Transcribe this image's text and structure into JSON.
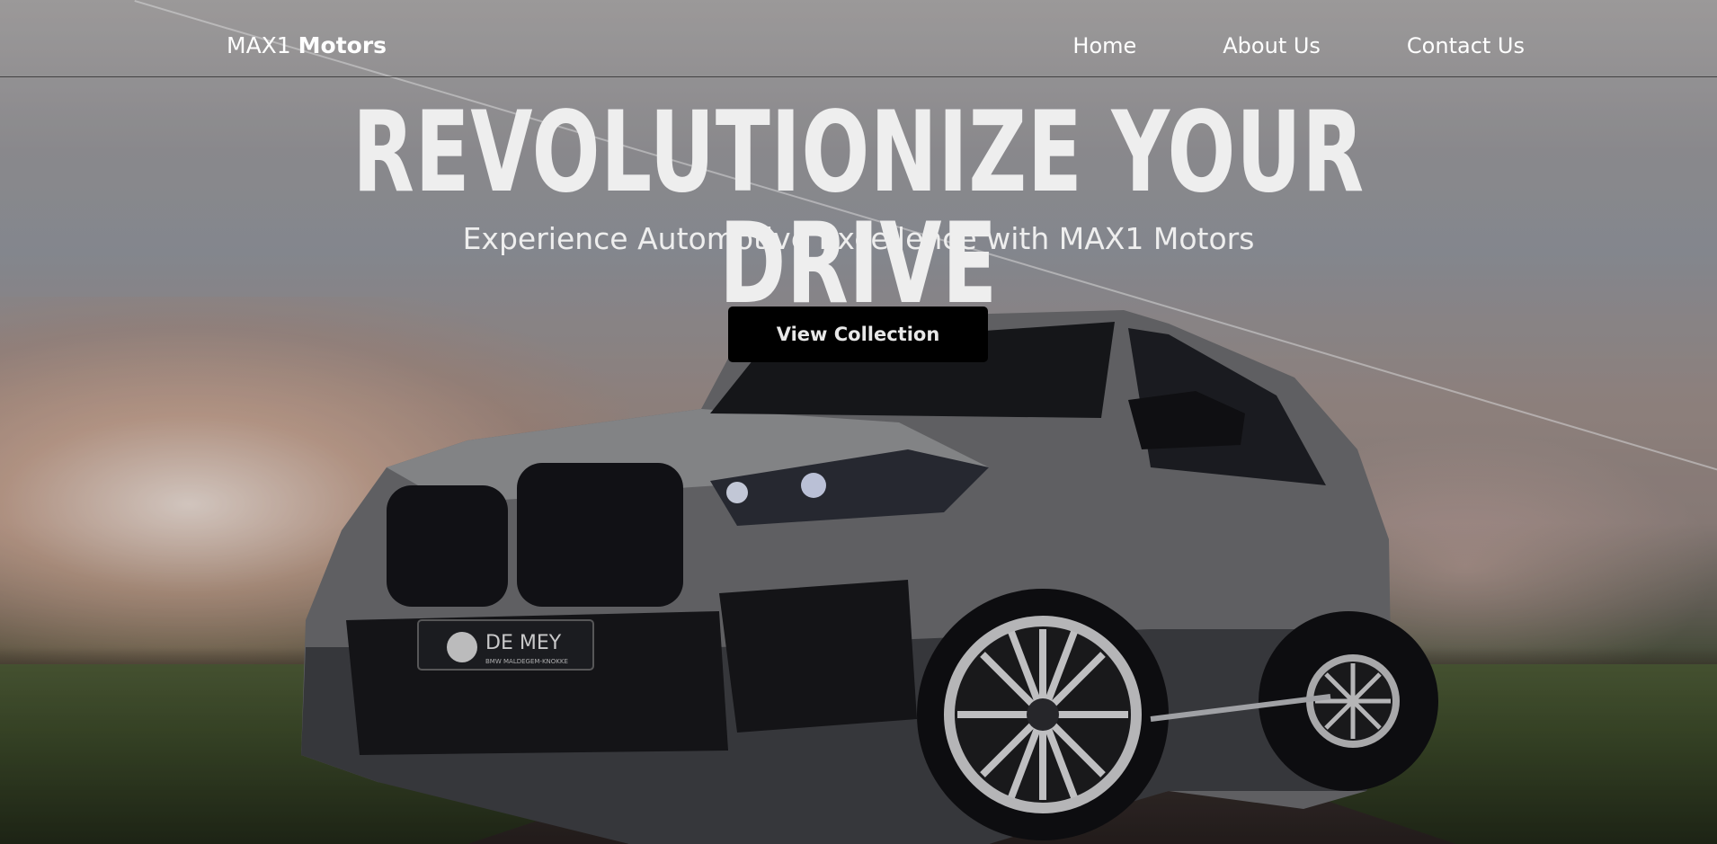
{
  "navbar": {
    "brand_light": "MAX1 ",
    "brand_bold": "Motors",
    "links": [
      {
        "label": "Home"
      },
      {
        "label": "About Us"
      },
      {
        "label": "Contact Us"
      }
    ]
  },
  "hero": {
    "headline": "REVOLUTIONIZE YOUR DRIVE",
    "subtitle": "Experience Automotive Excellence with MAX1 Motors",
    "cta_label": "View Collection",
    "plate_text": "DE MEY",
    "plate_subtext": "BMW MALDEGEM-KNOKKE"
  },
  "colors": {
    "cta_background": "#000000",
    "text": "#eeeeee"
  }
}
